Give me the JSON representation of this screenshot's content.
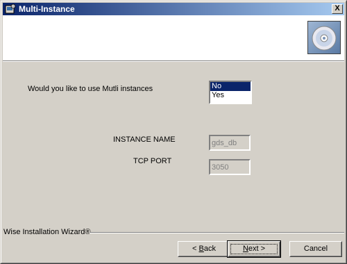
{
  "window": {
    "title": "Multi-Instance",
    "close_glyph": "X"
  },
  "icons": {
    "app": "setup-icon",
    "banner": "cd-disc-icon"
  },
  "question": {
    "label": "Would you like to use Mutli instances"
  },
  "listbox": {
    "options": [
      "No",
      "Yes"
    ],
    "selected": "No"
  },
  "fields": {
    "instance_name": {
      "label": "INSTANCE NAME",
      "value": "gds_db"
    },
    "tcp_port": {
      "label": "TCP PORT",
      "value": "3050"
    }
  },
  "footer": {
    "brand": "Wise Installation Wizard®"
  },
  "buttons": {
    "back_prefix": "< ",
    "back_u": "B",
    "back_rest": "ack",
    "next_u": "N",
    "next_rest": "ext >",
    "cancel": "Cancel"
  },
  "colors": {
    "titlebar": "#0a246a",
    "face": "#d4d0c8",
    "selection": "#0a246a"
  }
}
